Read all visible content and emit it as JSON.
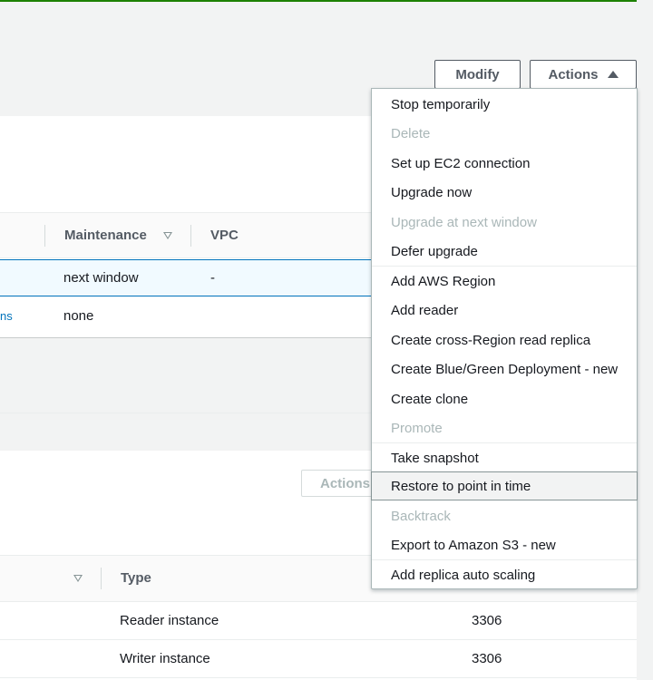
{
  "header": {
    "modify_label": "Modify",
    "actions_label": "Actions"
  },
  "db_table": {
    "columns": [
      "Maintenance",
      "VPC"
    ],
    "rows": [
      {
        "maintenance": "next window",
        "vpc": "-",
        "left_fragment": ""
      },
      {
        "maintenance": "none",
        "vpc": "",
        "left_fragment": "ns"
      }
    ]
  },
  "instances": {
    "actions_label": "Actions",
    "type_header": "Type",
    "rows": [
      {
        "type": "Reader instance",
        "port": "3306"
      },
      {
        "type": "Writer instance",
        "port": "3306"
      }
    ]
  },
  "actions_menu": {
    "items": [
      {
        "label": "Stop temporarily",
        "disabled": false
      },
      {
        "label": "Delete",
        "disabled": true
      },
      {
        "label": "Set up EC2 connection",
        "disabled": false
      },
      {
        "label": "Upgrade now",
        "disabled": false
      },
      {
        "label": "Upgrade at next window",
        "disabled": true
      },
      {
        "label": "Defer upgrade",
        "disabled": false
      },
      {
        "label": "Add AWS Region",
        "disabled": false
      },
      {
        "label": "Add reader",
        "disabled": false
      },
      {
        "label": "Create cross-Region read replica",
        "disabled": false
      },
      {
        "label": "Create Blue/Green Deployment - new",
        "disabled": false
      },
      {
        "label": "Create clone",
        "disabled": false
      },
      {
        "label": "Promote",
        "disabled": true
      },
      {
        "label": "Take snapshot",
        "disabled": false
      },
      {
        "label": "Restore to point in time",
        "disabled": false,
        "hovered": true
      },
      {
        "label": "Backtrack",
        "disabled": true
      },
      {
        "label": "Export to Amazon S3 - new",
        "disabled": false
      },
      {
        "label": "Add replica auto scaling",
        "disabled": false
      }
    ]
  },
  "colors": {
    "accent": "#0073bb",
    "success_strip": "#1d8102",
    "disabled_text": "#aab7b8"
  }
}
